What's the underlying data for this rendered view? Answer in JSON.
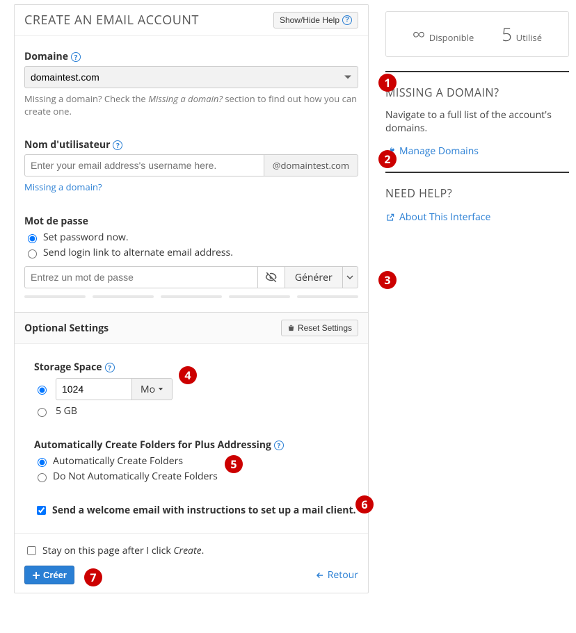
{
  "header": {
    "title": "Create an Email Account",
    "help_btn": "Show/Hide Help"
  },
  "domain": {
    "label": "Domaine",
    "value": "domaintest.com",
    "hint_pre": "Missing a domain? Check the ",
    "hint_em": "Missing a domain?",
    "hint_post": " section to find out how you can create one."
  },
  "username": {
    "label": "Nom d'utilisateur",
    "placeholder": "Enter your email address's username here.",
    "addon": "@domaintest.com",
    "missing_link": "Missing a domain?"
  },
  "password": {
    "label": "Mot de passe",
    "opt_now": "Set password now.",
    "opt_link": "Send login link to alternate email address.",
    "placeholder": "Entrez un mot de passe",
    "generate": "Générer"
  },
  "optional": {
    "title": "Optional Settings",
    "reset_btn": "Reset Settings",
    "storage": {
      "label": "Storage Space",
      "value": "1024",
      "unit": "Mo",
      "alt": "5 GB"
    },
    "folders": {
      "label": "Automatically Create Folders for Plus Addressing",
      "opt_auto": "Automatically Create Folders",
      "opt_no": "Do Not Automatically Create Folders"
    },
    "welcome": "Send a welcome email with instructions to set up a mail client."
  },
  "footer": {
    "stay_pre": "Stay on this page after I click ",
    "stay_em": "Create",
    "stay_post": ".",
    "create_btn": "Créer",
    "back_btn": "Retour"
  },
  "side": {
    "available_value": "∞",
    "available_label": "Disponible",
    "used_value": "5",
    "used_label": "Utilisé",
    "missing_title": "Missing a Domain?",
    "missing_text": "Navigate to a full list of the account's domains.",
    "manage_link": "Manage Domains",
    "help_title": "Need Help?",
    "about_link": "About This Interface"
  },
  "markers": [
    "1",
    "2",
    "3",
    "4",
    "5",
    "6",
    "7"
  ]
}
